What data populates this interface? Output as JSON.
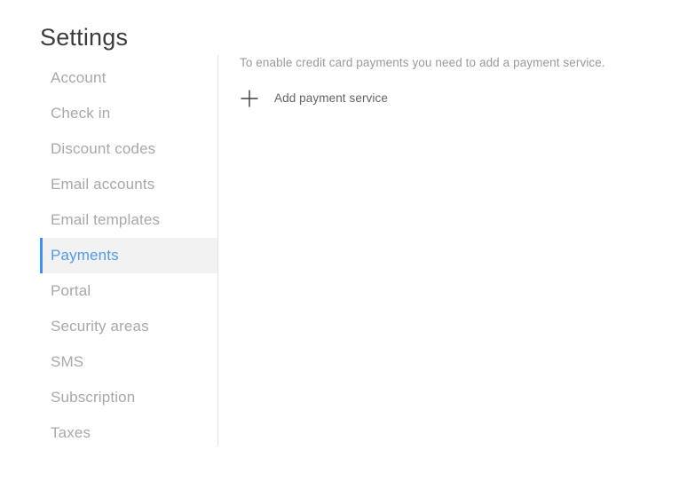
{
  "page": {
    "title": "Settings",
    "background_color": "#ffffff"
  },
  "theme": {
    "accent_color": "#3b93f0",
    "selected_text_color": "#4f9ce8",
    "selected_row_background": "#f2f2f2",
    "nav_text_color": "#a8a8a8",
    "divider_color": "#e2e2e2",
    "body_text_color": "#9a9a9a",
    "action_text_color": "#636363"
  },
  "sidebar": {
    "items": [
      {
        "label": "Account",
        "selected": false
      },
      {
        "label": "Check in",
        "selected": false
      },
      {
        "label": "Discount codes",
        "selected": false
      },
      {
        "label": "Email accounts",
        "selected": false
      },
      {
        "label": "Email templates",
        "selected": false
      },
      {
        "label": "Payments",
        "selected": true
      },
      {
        "label": "Portal",
        "selected": false
      },
      {
        "label": "Security areas",
        "selected": false
      },
      {
        "label": "SMS",
        "selected": false
      },
      {
        "label": "Subscription",
        "selected": false
      },
      {
        "label": "Taxes",
        "selected": false
      }
    ]
  },
  "main": {
    "description": "To enable credit card payments you need to add a payment service.",
    "add_payment_service": {
      "label": "Add payment service",
      "icon": "plus-icon"
    }
  }
}
